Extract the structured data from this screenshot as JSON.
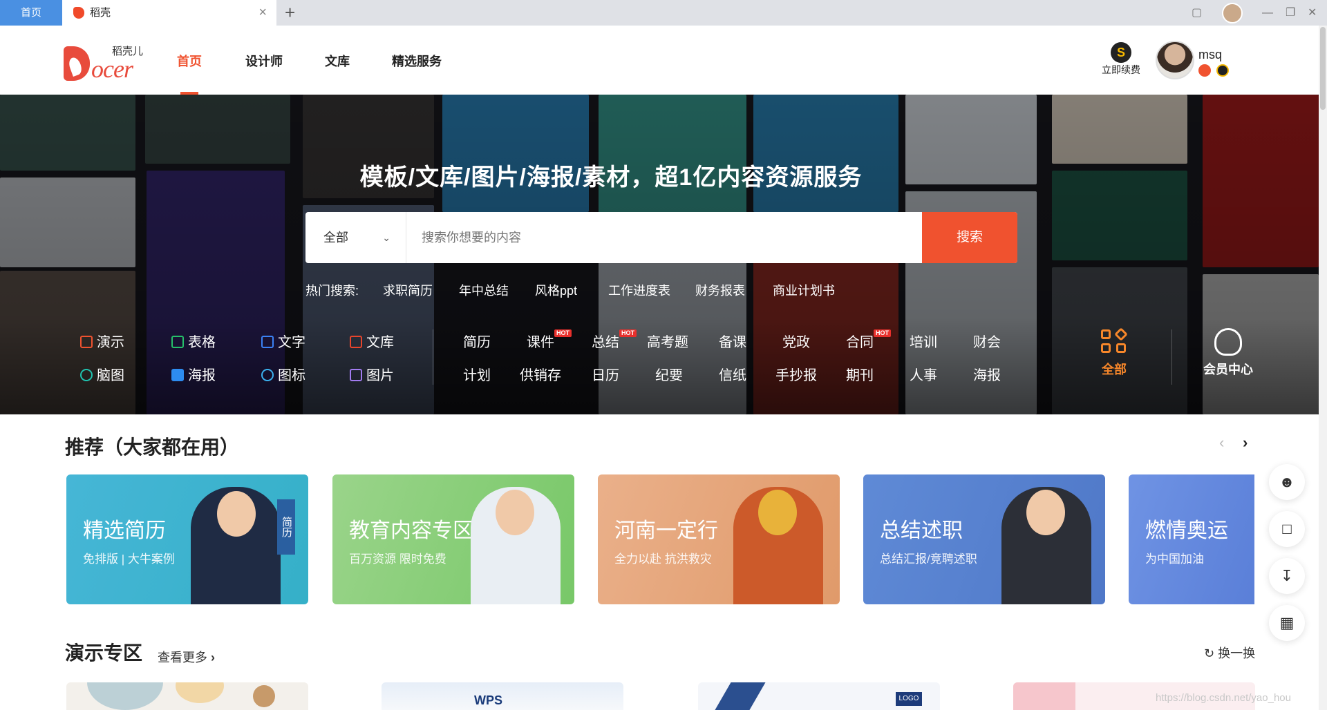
{
  "browser": {
    "home_tab": "首页",
    "active_tab": "稻壳",
    "close_symbol": "×",
    "add_symbol": "+"
  },
  "header": {
    "logo_text_cn": "稻壳儿",
    "logo_text_en": "ocer",
    "nav": [
      "首页",
      "设计师",
      "文库",
      "精选服务"
    ],
    "renew_label": "立即续费",
    "renew_badge": "S",
    "username": "msq",
    "accent_color": "#f0522f"
  },
  "hero": {
    "title": "模板/文库/图片/海报/素材，超1亿内容资源服务",
    "search_category": "全部",
    "search_placeholder": "搜索你想要的内容",
    "search_button": "搜索",
    "hot_label": "热门搜索:",
    "hot_terms": [
      "求职简历",
      "年中总结",
      "风格ppt",
      "工作进度表",
      "财务报表",
      "商业计划书"
    ],
    "apps_row1": [
      "演示",
      "表格",
      "文字",
      "文库"
    ],
    "apps_row2": [
      "脑图",
      "海报",
      "图标",
      "图片"
    ],
    "cats_row1": [
      "简历",
      "课件",
      "总结",
      "高考题",
      "备课",
      "党政",
      "合同",
      "培训",
      "财会"
    ],
    "cats_row2": [
      "计划",
      "供销存",
      "日历",
      "纪要",
      "信纸",
      "手抄报",
      "期刊",
      "人事",
      "海报"
    ],
    "hot_tag": "HOT",
    "all_label": "全部",
    "vip_label": "会员中心"
  },
  "recommend": {
    "title": "推荐（大家都在用）",
    "prev": "‹",
    "next": "›",
    "cards": [
      {
        "title": "精选简历",
        "sub": "免排版 | 大牛案例",
        "tag": "简历",
        "color": "#3fb5d0"
      },
      {
        "title": "教育内容专区",
        "sub": "百万资源 限时免费",
        "color": "#8ccf7a"
      },
      {
        "title": "河南一定行",
        "sub": "全力以赴 抗洪救灾",
        "color": "#e7a477"
      },
      {
        "title": "总结述职",
        "sub": "总结汇报/竞聘述职",
        "color": "#5b84d3"
      },
      {
        "title": "燃情奥运",
        "sub": "为中国加油",
        "color": "#6b8ee0"
      }
    ]
  },
  "presentation": {
    "title": "演示专区",
    "more": "查看更多",
    "refresh": "换一换"
  },
  "side_tools": [
    "user-icon",
    "chat-icon",
    "download-icon",
    "qrcode-icon"
  ],
  "watermark": "https://blog.csdn.net/yao_hou"
}
